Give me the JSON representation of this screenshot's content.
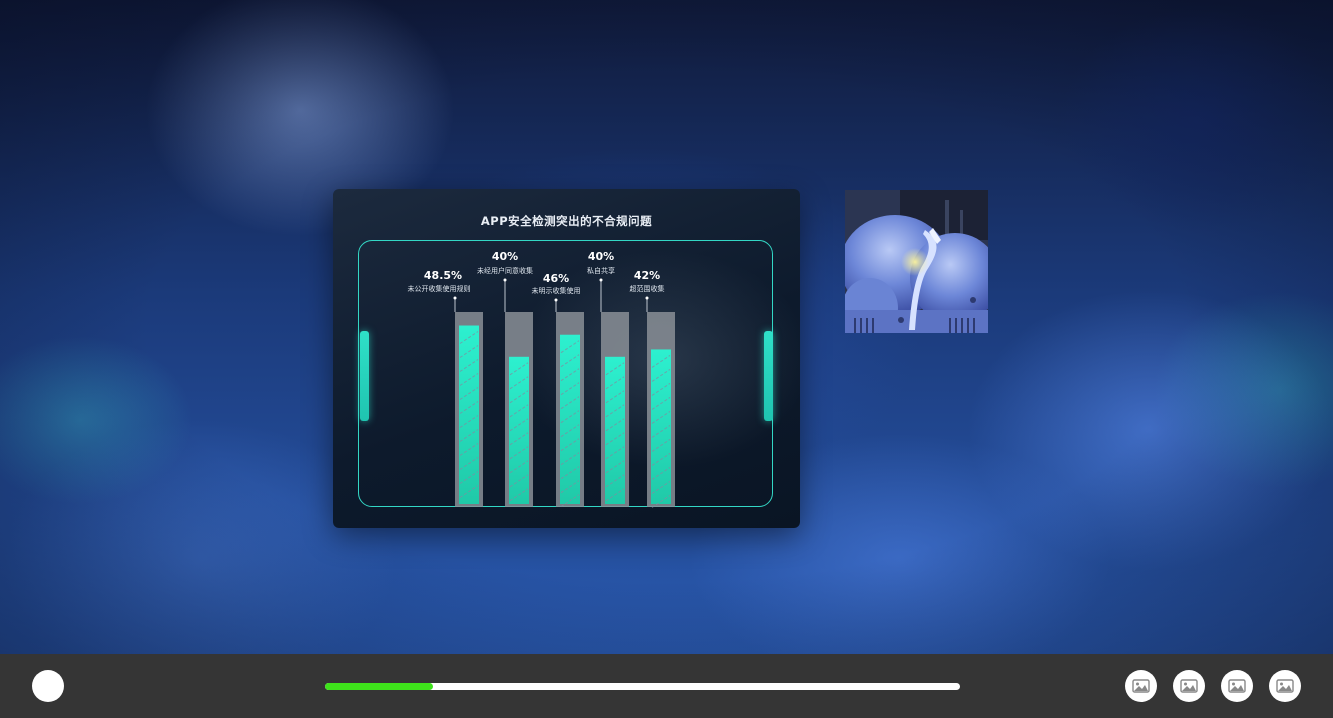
{
  "slide": {
    "title": "APP安全检测突出的不合规问题"
  },
  "chart_data": {
    "type": "bar",
    "title": "APP安全检测突出的不合规问题",
    "categories": [
      "未公开收集使用规则",
      "未经用户同意收集",
      "未明示收集使用",
      "私自共享",
      "超范围收集"
    ],
    "value_labels": [
      "48.5%",
      "40%",
      "46%",
      "40%",
      "42%"
    ],
    "values": [
      48.5,
      40,
      46,
      40,
      42
    ],
    "ylim": [
      0,
      100
    ],
    "colors": {
      "bar_fill": "#2ee6c6",
      "bar_track": "#8a8f96",
      "frame": "#33d7c5"
    }
  },
  "controls": {
    "progress": 0.17,
    "progress_color": "#3ee21b",
    "thumbnail_buttons": [
      "image-icon",
      "image-icon",
      "image-icon",
      "image-icon"
    ]
  }
}
